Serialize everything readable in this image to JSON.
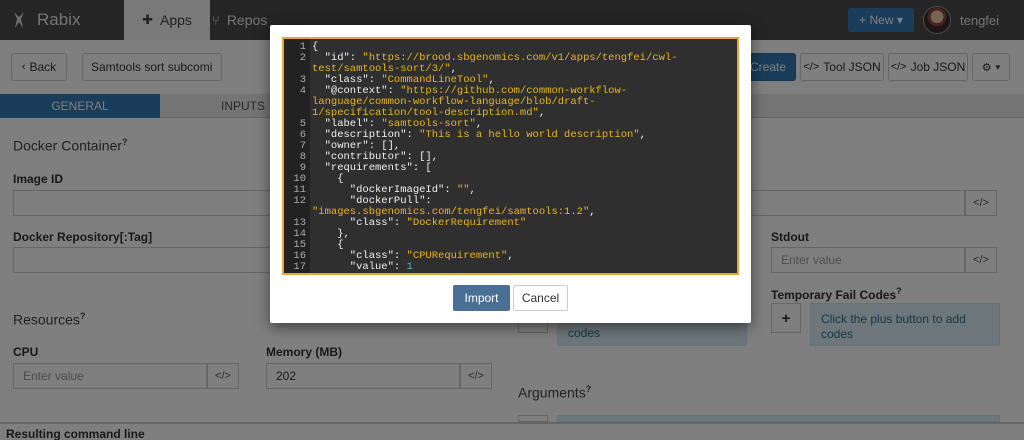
{
  "app": {
    "brand": "Rabix",
    "nav_tabs": [
      {
        "label": "Apps",
        "active": true
      },
      {
        "label": "Repos",
        "active": false
      }
    ],
    "new_button": "+ New ▾",
    "username": "tengfei"
  },
  "toolbar": {
    "back_label": "Back",
    "app_title": "Samtools sort subcomi",
    "create_label": "Create",
    "tool_json_label": "Tool JSON",
    "job_json_label": "Job JSON",
    "settings_label": "▾"
  },
  "subtabs": [
    {
      "label": "GENERAL",
      "active": true
    },
    {
      "label": "INPUTS",
      "active": false
    }
  ],
  "general": {
    "docker_container_title": "Docker Container",
    "help_mark": "?",
    "image_id_label": "Image ID",
    "image_id_value": "",
    "docker_repo_label": "Docker Repository[:Tag]",
    "docker_repo_value": "",
    "resources_title": "Resources",
    "cpu_label": "CPU",
    "cpu_placeholder": "Enter value",
    "memory_label": "Memory (MB)",
    "memory_value": "202",
    "stdout_label": "Stdout",
    "stdout_placeholder": "Enter value",
    "temp_fail_label": "Temporary Fail Codes",
    "temp_fail_info": "Click the plus button to add codes",
    "success_codes_info_visible": "codes",
    "arguments_title": "Arguments",
    "resulting_command_line": "Resulting command line",
    "code_icon": "</>"
  },
  "modal": {
    "import_label": "Import",
    "cancel_label": "Cancel",
    "code_lines": [
      {
        "n": "1",
        "parts": [
          {
            "t": "tx",
            "v": "{"
          }
        ]
      },
      {
        "n": "2",
        "parts": [
          {
            "t": "tx",
            "v": "  \"id\": "
          },
          {
            "t": "str",
            "v": "\"https://brood.sbgenomics.com/v1/apps/tengfei/cwl-"
          }
        ]
      },
      {
        "n": "",
        "parts": [
          {
            "t": "str",
            "v": "test/samtools-sort/3/\""
          },
          {
            "t": "tx",
            "v": ","
          }
        ]
      },
      {
        "n": "3",
        "parts": [
          {
            "t": "tx",
            "v": "  \"class\": "
          },
          {
            "t": "str",
            "v": "\"CommandLineTool\""
          },
          {
            "t": "tx",
            "v": ","
          }
        ]
      },
      {
        "n": "4",
        "parts": [
          {
            "t": "tx",
            "v": "  \"@context\": "
          },
          {
            "t": "str",
            "v": "\"https://github.com/common-workflow-"
          }
        ]
      },
      {
        "n": "",
        "parts": [
          {
            "t": "str",
            "v": "language/common-workflow-language/blob/draft-"
          }
        ]
      },
      {
        "n": "",
        "parts": [
          {
            "t": "str",
            "v": "1/specification/tool-description.md\""
          },
          {
            "t": "tx",
            "v": ","
          }
        ]
      },
      {
        "n": "5",
        "parts": [
          {
            "t": "tx",
            "v": "  \"label\": "
          },
          {
            "t": "str",
            "v": "\"samtools-sort\""
          },
          {
            "t": "tx",
            "v": ","
          }
        ]
      },
      {
        "n": "6",
        "parts": [
          {
            "t": "tx",
            "v": "  \"description\": "
          },
          {
            "t": "str",
            "v": "\"This is a hello world description\""
          },
          {
            "t": "tx",
            "v": ","
          }
        ]
      },
      {
        "n": "7",
        "parts": [
          {
            "t": "tx",
            "v": "  \"owner\": [],"
          }
        ]
      },
      {
        "n": "8",
        "parts": [
          {
            "t": "tx",
            "v": "  \"contributor\": [],"
          }
        ]
      },
      {
        "n": "9",
        "parts": [
          {
            "t": "tx",
            "v": "  \"requirements\": ["
          }
        ]
      },
      {
        "n": "10",
        "parts": [
          {
            "t": "tx",
            "v": "    {"
          }
        ]
      },
      {
        "n": "11",
        "parts": [
          {
            "t": "tx",
            "v": "      \"dockerImageId\": "
          },
          {
            "t": "str",
            "v": "\"\""
          },
          {
            "t": "tx",
            "v": ","
          }
        ]
      },
      {
        "n": "12",
        "parts": [
          {
            "t": "tx",
            "v": "      \"dockerPull\":"
          }
        ]
      },
      {
        "n": "",
        "parts": [
          {
            "t": "str",
            "v": "\"images.sbgenomics.com/tengfei/samtools:1.2\""
          },
          {
            "t": "tx",
            "v": ","
          }
        ]
      },
      {
        "n": "13",
        "parts": [
          {
            "t": "tx",
            "v": "      \"class\": "
          },
          {
            "t": "str",
            "v": "\"DockerRequirement\""
          }
        ]
      },
      {
        "n": "14",
        "parts": [
          {
            "t": "tx",
            "v": "    },"
          }
        ]
      },
      {
        "n": "15",
        "parts": [
          {
            "t": "tx",
            "v": "    {"
          }
        ]
      },
      {
        "n": "16",
        "parts": [
          {
            "t": "tx",
            "v": "      \"class\": "
          },
          {
            "t": "str",
            "v": "\"CPURequirement\""
          },
          {
            "t": "tx",
            "v": ","
          }
        ]
      },
      {
        "n": "17",
        "parts": [
          {
            "t": "tx",
            "v": "      \"value\": "
          },
          {
            "t": "num",
            "v": "1"
          }
        ]
      }
    ]
  }
}
